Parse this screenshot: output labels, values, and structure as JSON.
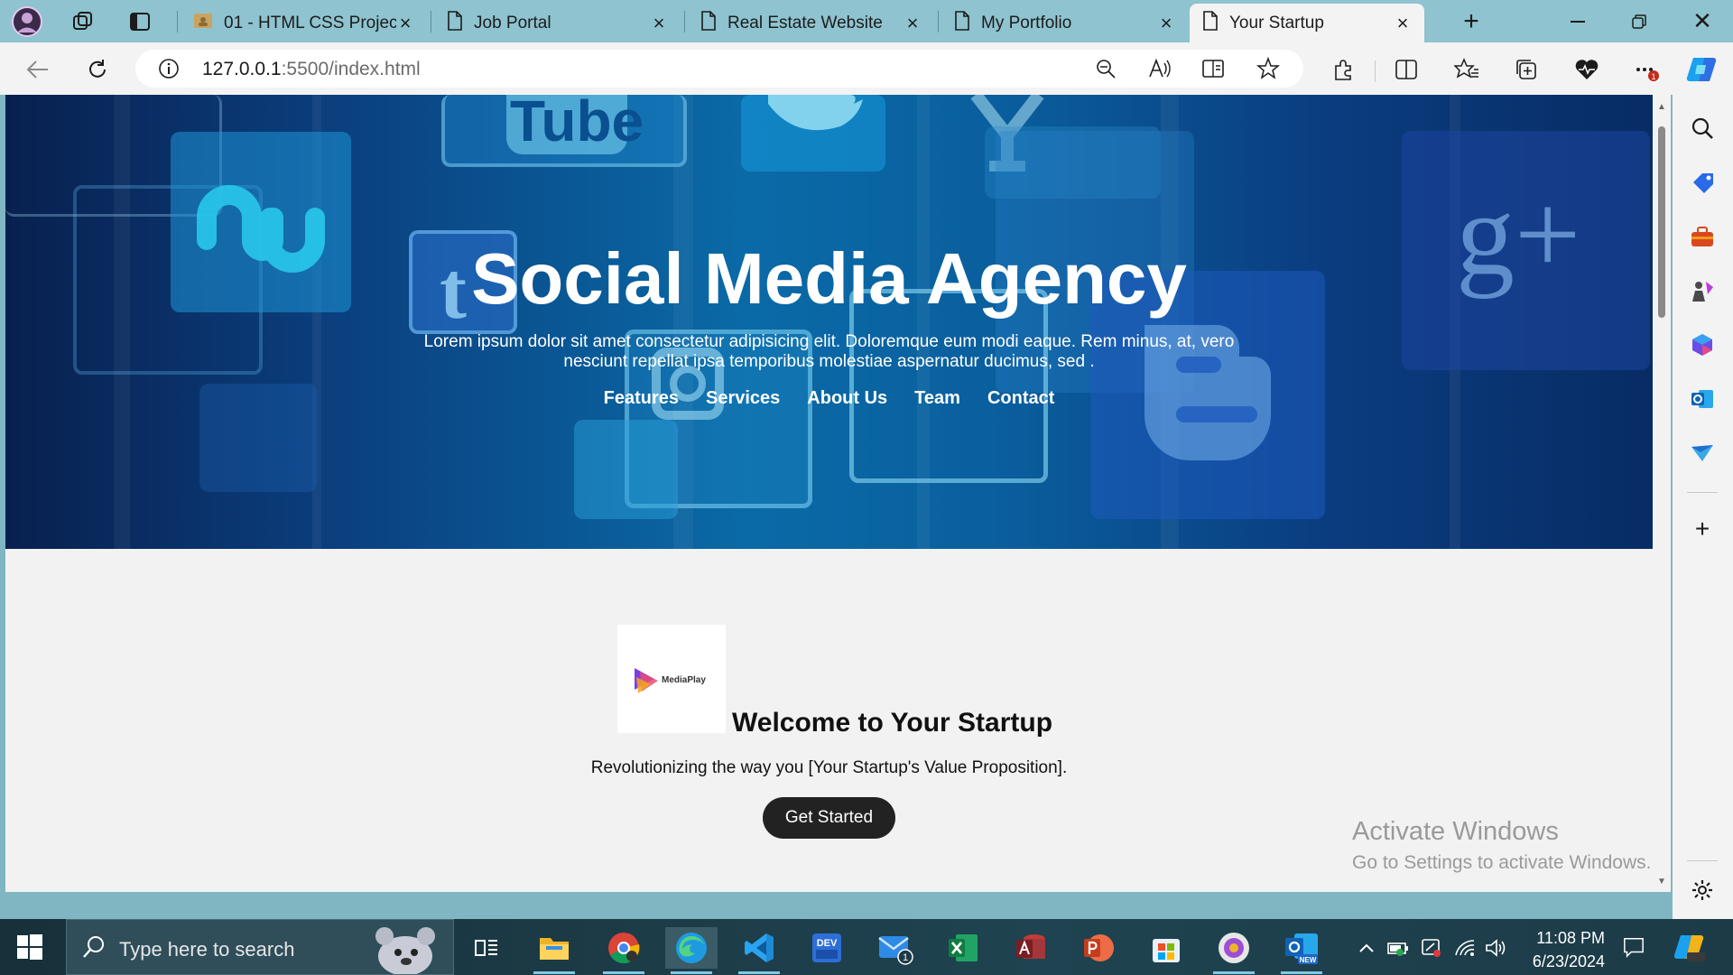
{
  "browser": {
    "tabs": [
      {
        "label": "01 - HTML CSS Projects",
        "active": false
      },
      {
        "label": "Job Portal",
        "active": false
      },
      {
        "label": "Real Estate Website",
        "active": false
      },
      {
        "label": "My Portfolio",
        "active": false
      },
      {
        "label": "Your Startup",
        "active": true
      }
    ],
    "url_host": "127.0.0.1",
    "url_rest": ":5500/index.html",
    "notification_count": "1"
  },
  "page": {
    "hero_title": "Social Media Agency",
    "hero_text": "Lorem ipsum dolor sit amet consectetur adipisicing elit. Doloremque eum modi eaque. Rem minus, at, vero nesciunt repellat ipsa temporibus molestiae aspernatur ducimus, sed .",
    "nav": [
      "Features",
      "Services",
      "About Us",
      "Team",
      "Contact"
    ],
    "logo_text": "MediaPlay",
    "welcome_title": "Welcome to Your Startup",
    "welcome_text": "Revolutionizing the way you [Your Startup's Value Proposition].",
    "cta_label": "Get Started",
    "background_glyphs": [
      "Tube",
      "t",
      "g+"
    ]
  },
  "watermark": {
    "line1": "Activate Windows",
    "line2": "Go to Settings to activate Windows."
  },
  "taskbar": {
    "search_placeholder": "Type here to search",
    "time": "11:08 PM",
    "date": "6/23/2024",
    "mail_badge": "1",
    "outlook_badge": "NEW",
    "devtools_label": "DEV"
  },
  "colors": {
    "titlebar": "#8ec3cf",
    "hero_dark": "#08204f",
    "hero_light": "#0a6aa7",
    "cta_bg": "#222222",
    "taskbar": "#1e3a45"
  }
}
